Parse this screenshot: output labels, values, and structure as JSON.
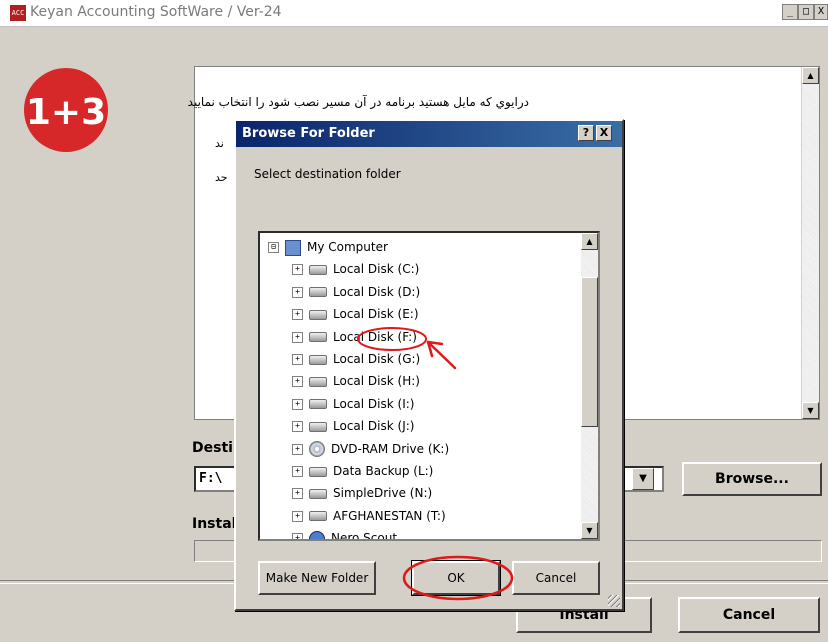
{
  "window": {
    "title": "Keyan Accounting SoftWare / Ver-24",
    "icon_text": "ACC",
    "minimize_glyph": "_",
    "maximize_glyph": "□",
    "close_glyph": "X"
  },
  "logo": {
    "text": "1+3",
    "color": "#d62828"
  },
  "info": {
    "line1": "درایوي که مایل هستید برنامه در آن مسیر نصب شود را انتخاب نمایید",
    "line2": "ند",
    "line3": "حد"
  },
  "destination": {
    "label": "Desti",
    "value": "F:\\",
    "dropdown_glyph": "▼"
  },
  "browse_button": {
    "label": "Browse..."
  },
  "install_section": {
    "label": "Instal",
    "progress": 0
  },
  "footer": {
    "install_label": "Install",
    "cancel_label": "Cancel"
  },
  "dialog": {
    "title": "Browse For Folder",
    "help_glyph": "?",
    "close_glyph": "X",
    "description": "Select destination folder",
    "tree": [
      {
        "label": "My Computer",
        "icon": "computer-icon",
        "expander": "⊟"
      },
      {
        "label": "Local Disk (C:)",
        "icon": "drive-icon",
        "expander": "+"
      },
      {
        "label": "Local Disk (D:)",
        "icon": "drive-icon",
        "expander": "+"
      },
      {
        "label": "Local Disk (E:)",
        "icon": "drive-icon",
        "expander": "+"
      },
      {
        "label": "Local Disk (F:)",
        "icon": "drive-icon",
        "expander": "+"
      },
      {
        "label": "Local Disk (G:)",
        "icon": "drive-icon",
        "expander": "+"
      },
      {
        "label": "Local Disk (H:)",
        "icon": "drive-icon",
        "expander": "+"
      },
      {
        "label": "Local Disk (I:)",
        "icon": "drive-icon",
        "expander": "+"
      },
      {
        "label": "Local Disk (J:)",
        "icon": "drive-icon",
        "expander": "+"
      },
      {
        "label": "DVD-RAM Drive (K:)",
        "icon": "dvd-icon",
        "expander": "+"
      },
      {
        "label": "Data Backup (L:)",
        "icon": "drive-icon",
        "expander": "+"
      },
      {
        "label": "SimpleDrive (N:)",
        "icon": "drive-icon",
        "expander": "+"
      },
      {
        "label": "AFGHANESTAN (T:)",
        "icon": "drive-icon",
        "expander": "+"
      },
      {
        "label": "Nero Scout",
        "icon": "network-icon",
        "expander": "+"
      }
    ],
    "scroll_up_glyph": "▲",
    "scroll_down_glyph": "▼",
    "new_folder_label": "Make New Folder",
    "ok_label": "OK",
    "cancel_label": "Cancel"
  },
  "annotation_color": "#e01818"
}
